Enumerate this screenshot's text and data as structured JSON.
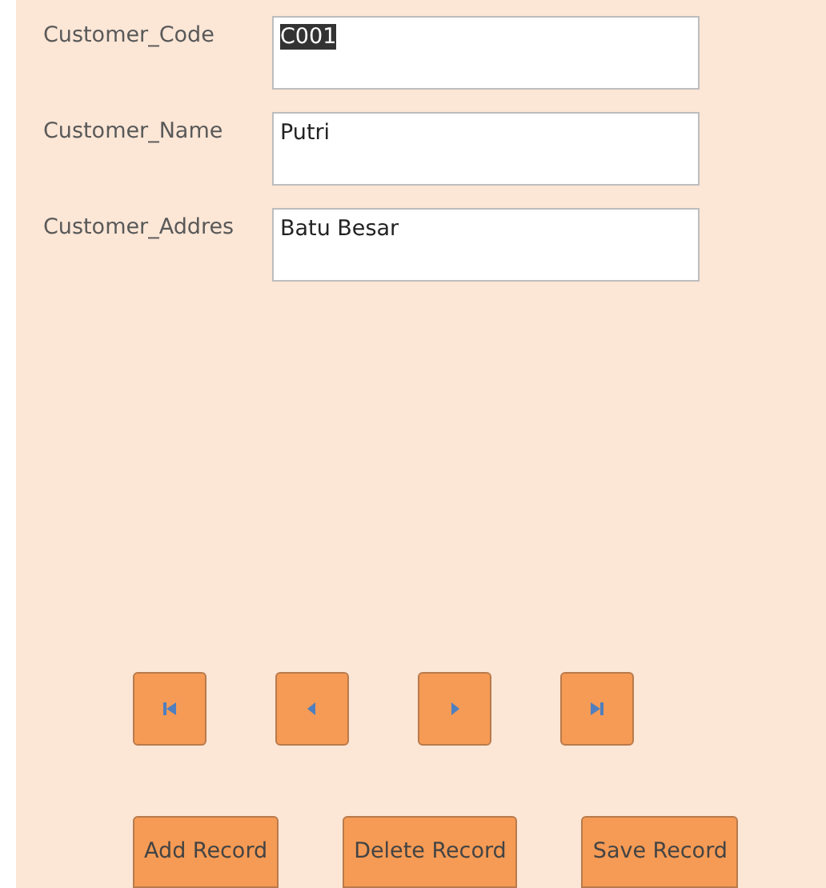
{
  "fields": [
    {
      "label": "Customer_Code",
      "value": "C001",
      "text_selected": true
    },
    {
      "label": "Customer_Name",
      "value": "Putri",
      "text_selected": false
    },
    {
      "label": "Customer_Addres",
      "value": "Batu Besar",
      "text_selected": false
    }
  ],
  "navigation": [
    {
      "kind": "first"
    },
    {
      "kind": "previous"
    },
    {
      "kind": "next"
    },
    {
      "kind": "last"
    }
  ],
  "buttons": [
    "Add Record",
    "Delete Record",
    "Save Record"
  ]
}
